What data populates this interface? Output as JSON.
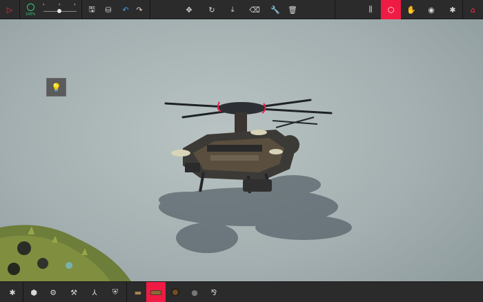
{
  "toolbar": {
    "play_glyph": "▷",
    "time_scale": "100%",
    "save_glyph": "🖫",
    "load_glyph": "⛁",
    "undo_glyph": "↶",
    "redo_glyph": "↷",
    "move_glyph": "✥",
    "rotate_glyph": "↻",
    "center_glyph": "⤓",
    "erase_glyph": "⌫",
    "wrench_glyph": "🔧",
    "trash_glyph": "🗑",
    "stats_glyph": "⫼",
    "build_glyph": "⬡",
    "hand_glyph": "✋",
    "camera_glyph": "◉",
    "settings_glyph": "✱",
    "home_glyph": "⌂"
  },
  "light_toggle": {
    "glyph": "💡"
  },
  "categories": [
    {
      "name": "settings",
      "glyph": "✱"
    },
    {
      "name": "basic-blocks",
      "glyph": "⬢"
    },
    {
      "name": "mechanical",
      "glyph": "⚙"
    },
    {
      "name": "tools",
      "glyph": "⚒"
    },
    {
      "name": "propulsion",
      "glyph": "⅄"
    },
    {
      "name": "armour",
      "glyph": "⛨"
    }
  ],
  "blocks": [
    {
      "name": "wooden-block",
      "glyph": "▬"
    },
    {
      "name": "log",
      "glyph": ""
    },
    {
      "name": "wheel",
      "glyph": ""
    },
    {
      "name": "bomb",
      "glyph": "●"
    },
    {
      "name": "grabber",
      "glyph": "⅋"
    }
  ],
  "colors": {
    "accent_red": "#ef1b45",
    "time_green": "#33d07a",
    "bar_bg": "#2b2b2b"
  }
}
